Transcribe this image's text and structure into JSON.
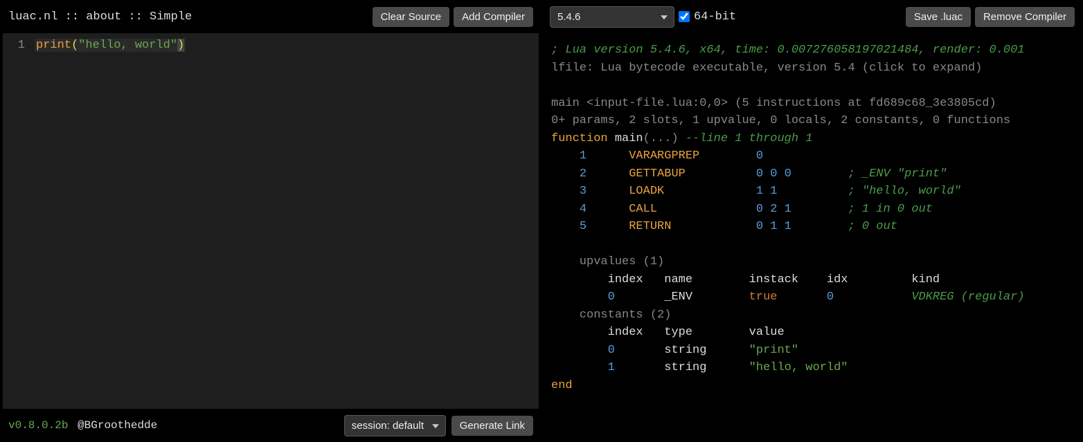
{
  "breadcrumb": "luac.nl :: about :: Simple",
  "buttons": {
    "clear_source": "Clear Source",
    "add_compiler": "Add Compiler",
    "save_luac": "Save .luac",
    "remove_compiler": "Remove Compiler",
    "generate_link": "Generate Link"
  },
  "editor": {
    "line_number": "1",
    "code_func": "print",
    "code_paren_open": "(",
    "code_string": "\"hello, world\"",
    "code_paren_close": ")"
  },
  "footer": {
    "version": "v0.8.0.2b",
    "author": "@BGroothedde",
    "session_label": "session: default"
  },
  "compiler": {
    "version_selected": "5.4.6",
    "arch_label": "64-bit"
  },
  "output": {
    "meta": "; Lua version 5.4.6, x64, time: 0.007276058197021484, render: 0.001",
    "lfile": "lfile: Lua bytecode executable, version 5.4 (click to expand)",
    "main_header": "main <input-file.lua:0,0> (5 instructions at fd689c68_3e3805cd)",
    "main_params": "0+ params, 2 slots, 1 upvalue, 0 locals, 2 constants, 0 functions",
    "func_kw": "function",
    "func_name": "main",
    "func_args": "(...)",
    "func_comment": "--line 1 through 1",
    "instructions": [
      {
        "n": "1",
        "op": "VARARGPREP",
        "args": "0",
        "comment": ""
      },
      {
        "n": "2",
        "op": "GETTABUP",
        "args": "0 0 0",
        "comment": "; _ENV \"print\""
      },
      {
        "n": "3",
        "op": "LOADK",
        "args": "1 1",
        "comment": "; \"hello, world\""
      },
      {
        "n": "4",
        "op": "CALL",
        "args": "0 2 1",
        "comment": "; 1 in 0 out"
      },
      {
        "n": "5",
        "op": "RETURN",
        "args": "0 1 1",
        "comment": "; 0 out"
      }
    ],
    "upvalues_header": "upvalues (1)",
    "upvalues_cols": {
      "c1": "index",
      "c2": "name",
      "c3": "instack",
      "c4": "idx",
      "c5": "kind"
    },
    "upvalue_row": {
      "index": "0",
      "name": "_ENV",
      "instack": "true",
      "idx": "0",
      "kind": "VDKREG (regular)"
    },
    "constants_header": "constants (2)",
    "constants_cols": {
      "c1": "index",
      "c2": "type",
      "c3": "value"
    },
    "constants": [
      {
        "index": "0",
        "type": "string",
        "value": "\"print\""
      },
      {
        "index": "1",
        "type": "string",
        "value": "\"hello, world\""
      }
    ],
    "end": "end"
  }
}
